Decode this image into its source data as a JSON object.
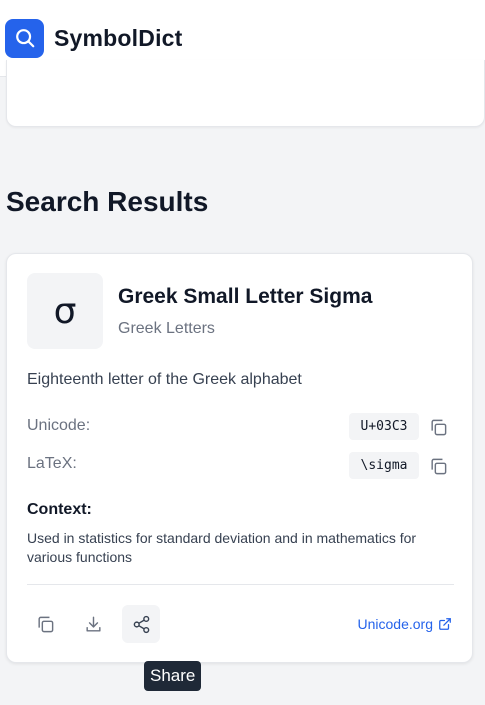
{
  "app": {
    "title": "SymbolDict",
    "logo_icon": "search-icon",
    "brand_color": "#2563eb"
  },
  "results": {
    "heading": "Search Results"
  },
  "symbol": {
    "glyph": "σ",
    "name": "Greek Small Letter Sigma",
    "category": "Greek Letters",
    "description": "Eighteenth letter of the Greek alphabet",
    "unicode_label": "Unicode:",
    "unicode_value": "U+03C3",
    "latex_label": "LaTeX:",
    "latex_value": "\\sigma",
    "context_label": "Context:",
    "context_text": "Used in statistics for standard deviation and in mathematics for various functions"
  },
  "actions": {
    "copy_icon": "copy-icon",
    "download_icon": "download-icon",
    "share_icon": "share-icon",
    "link_label": "Unicode.org",
    "link_icon": "external-link-icon"
  },
  "tooltip": {
    "text": "Share"
  }
}
